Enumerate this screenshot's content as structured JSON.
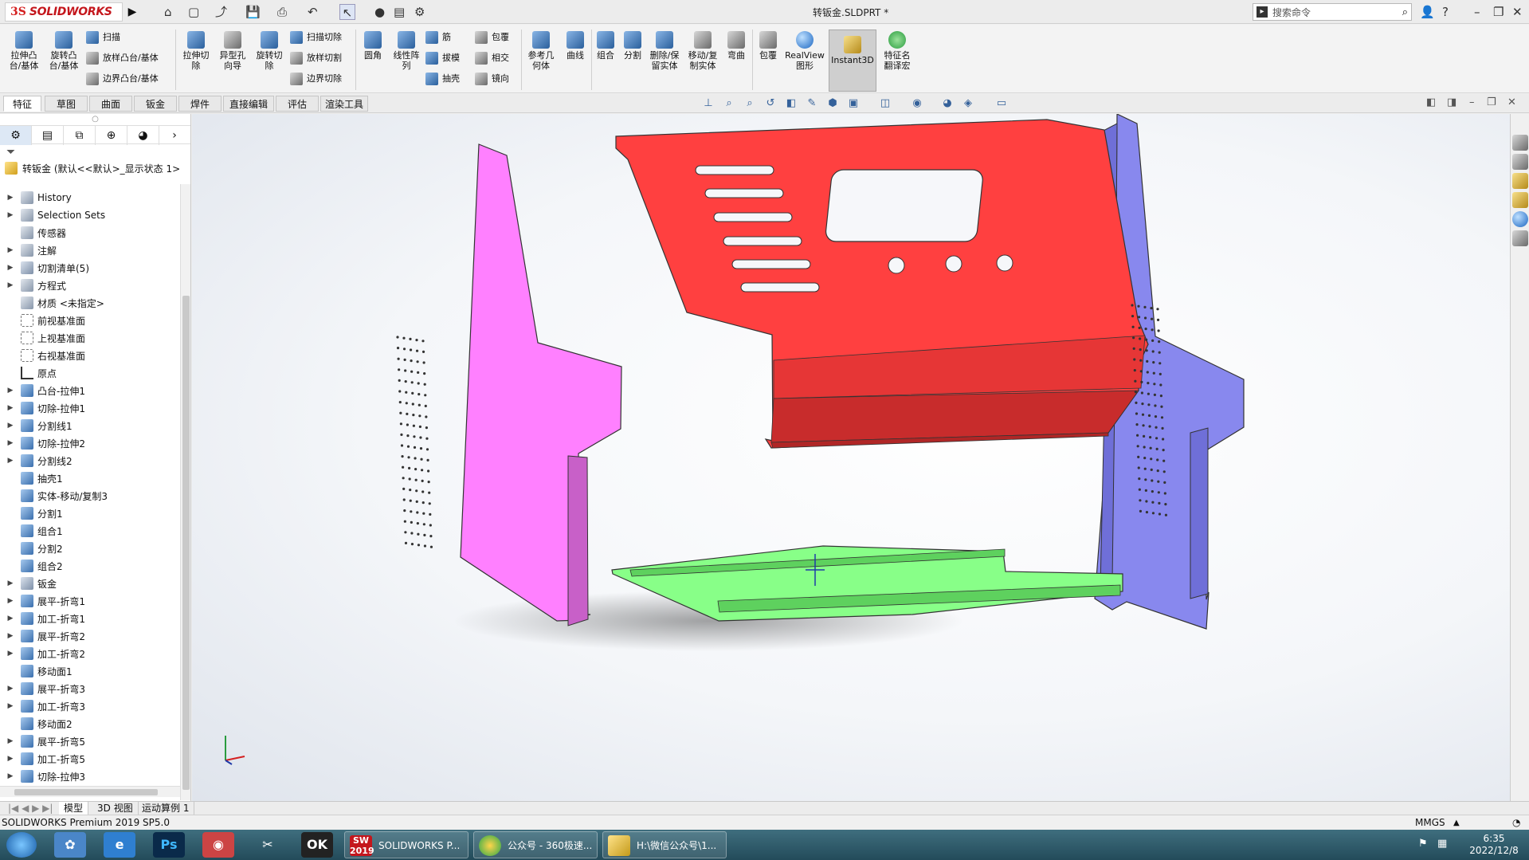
{
  "titlebar": {
    "brand": "SOLIDWORKS",
    "brand_mark": "3S",
    "document_title": "转钣金.SLDPRT *",
    "search_placeholder": "搜索命令"
  },
  "ribbon": {
    "buttons": [
      {
        "id": "extrude-boss",
        "label": "拉伸凸\n台/基体"
      },
      {
        "id": "revolve-boss",
        "label": "旋转凸\n台/基体"
      },
      {
        "id": "sweep",
        "label": "扫描"
      },
      {
        "id": "loft-boss",
        "label": "放样凸台/基体"
      },
      {
        "id": "boundary-boss",
        "label": "边界凸台/基体"
      },
      {
        "id": "extrude-cut",
        "label": "拉伸切\n除"
      },
      {
        "id": "hole-wizard",
        "label": "异型孔\n向导"
      },
      {
        "id": "revolve-cut",
        "label": "旋转切\n除"
      },
      {
        "id": "swept-cut",
        "label": "扫描切除"
      },
      {
        "id": "lofted-cut",
        "label": "放样切割"
      },
      {
        "id": "boundary-cut",
        "label": "边界切除"
      },
      {
        "id": "fillet",
        "label": "圆角"
      },
      {
        "id": "linear-pattern",
        "label": "线性阵\n列"
      },
      {
        "id": "rib",
        "label": "筋"
      },
      {
        "id": "draft",
        "label": "拔模"
      },
      {
        "id": "shell",
        "label": "抽壳"
      },
      {
        "id": "wrap",
        "label": "包覆"
      },
      {
        "id": "intersect",
        "label": "相交"
      },
      {
        "id": "mirror",
        "label": "镜向"
      },
      {
        "id": "ref-geometry",
        "label": "参考几\n何体"
      },
      {
        "id": "curves",
        "label": "曲线"
      },
      {
        "id": "combine",
        "label": "组合"
      },
      {
        "id": "split",
        "label": "分割"
      },
      {
        "id": "delete-keep",
        "label": "删除/保\n留实体"
      },
      {
        "id": "move-copy",
        "label": "移动/复\n制实体"
      },
      {
        "id": "flex",
        "label": "弯曲"
      },
      {
        "id": "wrap2",
        "label": "包覆"
      },
      {
        "id": "realview",
        "label": "RealView\n图形"
      },
      {
        "id": "instant3d",
        "label": "Instant3D"
      },
      {
        "id": "feature-name",
        "label": "特征名\n翻译宏"
      }
    ]
  },
  "tabs": [
    "特征",
    "草图",
    "曲面",
    "钣金",
    "焊件",
    "直接编辑",
    "评估",
    "渲染工具"
  ],
  "tree": {
    "root": "转钣金  (默认<<默认>_显示状态 1>",
    "items": [
      {
        "label": "History",
        "icon": "folder",
        "expandable": true
      },
      {
        "label": "Selection Sets",
        "icon": "folder",
        "expandable": true
      },
      {
        "label": "传感器",
        "icon": "folder",
        "expandable": false
      },
      {
        "label": "注解",
        "icon": "folder",
        "expandable": true
      },
      {
        "label": "切割清单(5)",
        "icon": "sheet",
        "expandable": true
      },
      {
        "label": "方程式",
        "icon": "folder",
        "expandable": true
      },
      {
        "label": "材质 <未指定>",
        "icon": "folder",
        "expandable": false
      },
      {
        "label": "前视基准面",
        "icon": "plane",
        "expandable": false
      },
      {
        "label": "上视基准面",
        "icon": "plane",
        "expandable": false
      },
      {
        "label": "右视基准面",
        "icon": "plane",
        "expandable": false
      },
      {
        "label": "原点",
        "icon": "origin",
        "expandable": false
      },
      {
        "label": "凸台-拉伸1",
        "icon": "feat",
        "expandable": true
      },
      {
        "label": "切除-拉伸1",
        "icon": "feat",
        "expandable": true
      },
      {
        "label": "分割线1",
        "icon": "feat",
        "expandable": true
      },
      {
        "label": "切除-拉伸2",
        "icon": "feat",
        "expandable": true
      },
      {
        "label": "分割线2",
        "icon": "feat",
        "expandable": true
      },
      {
        "label": "抽壳1",
        "icon": "feat",
        "expandable": false
      },
      {
        "label": "实体-移动/复制3",
        "icon": "feat",
        "expandable": false
      },
      {
        "label": "分割1",
        "icon": "feat",
        "expandable": false
      },
      {
        "label": "组合1",
        "icon": "feat",
        "expandable": false
      },
      {
        "label": "分割2",
        "icon": "feat",
        "expandable": false
      },
      {
        "label": "组合2",
        "icon": "feat",
        "expandable": false
      },
      {
        "label": "钣金",
        "icon": "sheet",
        "expandable": true
      },
      {
        "label": "展平-折弯1",
        "icon": "feat",
        "expandable": true
      },
      {
        "label": "加工-折弯1",
        "icon": "feat",
        "expandable": true
      },
      {
        "label": "展平-折弯2",
        "icon": "feat",
        "expandable": true
      },
      {
        "label": "加工-折弯2",
        "icon": "feat",
        "expandable": true
      },
      {
        "label": "移动面1",
        "icon": "feat",
        "expandable": false
      },
      {
        "label": "展平-折弯3",
        "icon": "feat",
        "expandable": true
      },
      {
        "label": "加工-折弯3",
        "icon": "feat",
        "expandable": true
      },
      {
        "label": "移动面2",
        "icon": "feat",
        "expandable": false
      },
      {
        "label": "展平-折弯5",
        "icon": "feat",
        "expandable": true
      },
      {
        "label": "加工-折弯5",
        "icon": "feat",
        "expandable": true
      },
      {
        "label": "切除-拉伸3",
        "icon": "feat",
        "expandable": true
      }
    ]
  },
  "model_tabs": [
    "模型",
    "3D 视图",
    "运动算例 1"
  ],
  "status": {
    "left": "SOLIDWORKS Premium 2019 SP5.0",
    "units": "MMGS"
  },
  "taskbar": {
    "windows": [
      "SOLIDWORKS P...",
      "公众号 - 360极速...",
      "H:\\微信公众号\\1..."
    ],
    "sw_badge": "SW",
    "sw_year": "2019",
    "time": "6:35",
    "date": "2022/12/8"
  },
  "colors": {
    "red_panel": "#ff4040",
    "magenta_panel": "#ff80ff",
    "blue_panel": "#8888ee",
    "green_panel": "#88ff88",
    "accent": "#c4161c"
  }
}
